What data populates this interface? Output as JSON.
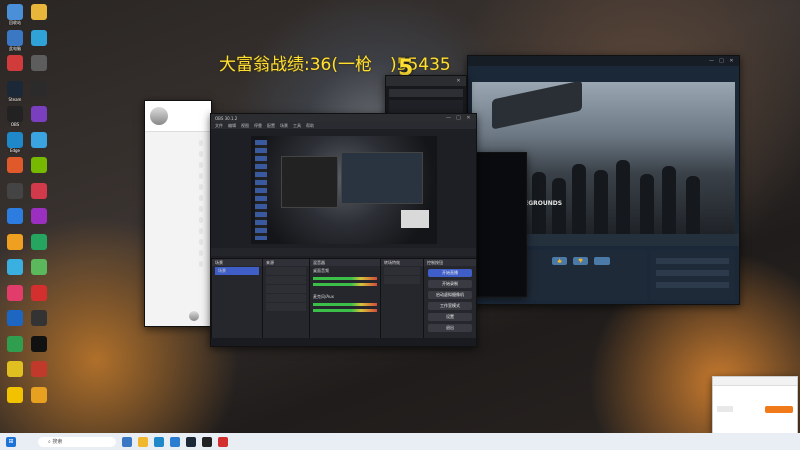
{
  "overlay": {
    "stats_text": "大富翁战绩:36(一枪",
    "stats_suffix": ")55435",
    "big_digit": "5"
  },
  "desktop_icons": [
    {
      "name": "recycle-bin-icon",
      "label": "回收站",
      "color": "#4a90d9"
    },
    {
      "name": "app-icon-2",
      "label": "",
      "color": "#e8b63a"
    },
    {
      "name": "computer-icon",
      "label": "此电脑",
      "color": "#3a78c4"
    },
    {
      "name": "app-icon-4",
      "label": "",
      "color": "#2fa3d8"
    },
    {
      "name": "app-icon-5",
      "label": "",
      "color": "#d23b3b"
    },
    {
      "name": "app-icon-6",
      "label": "",
      "color": "#5d5d5d"
    },
    {
      "name": "steam-icon",
      "label": "Steam",
      "color": "#1b2838"
    },
    {
      "name": "app-icon-8",
      "label": "",
      "color": "#2b2b2b"
    },
    {
      "name": "obs-icon",
      "label": "OBS",
      "color": "#222"
    },
    {
      "name": "app-icon-10",
      "label": "",
      "color": "#7a3fbf"
    },
    {
      "name": "edge-icon",
      "label": "Edge",
      "color": "#1e88c8"
    },
    {
      "name": "app-icon-12",
      "label": "",
      "color": "#3aa3e0"
    },
    {
      "name": "app-icon-13",
      "label": "",
      "color": "#e0592b"
    },
    {
      "name": "nvidia-icon",
      "label": "",
      "color": "#76b900"
    },
    {
      "name": "app-icon-15",
      "label": "",
      "color": "#444"
    },
    {
      "name": "app-icon-16",
      "label": "",
      "color": "#d13a4a"
    },
    {
      "name": "app-icon-17",
      "label": "",
      "color": "#2d7de0"
    },
    {
      "name": "app-icon-18",
      "label": "",
      "color": "#9b2fbf"
    },
    {
      "name": "app-icon-19",
      "label": "",
      "color": "#f0a020"
    },
    {
      "name": "app-icon-20",
      "label": "",
      "color": "#25a55f"
    },
    {
      "name": "app-icon-21",
      "label": "",
      "color": "#3ab0e0"
    },
    {
      "name": "app-icon-22",
      "label": "",
      "color": "#5cb85c"
    },
    {
      "name": "app-icon-23",
      "label": "",
      "color": "#e23c6a"
    },
    {
      "name": "app-icon-24",
      "label": "",
      "color": "#d32f2f"
    },
    {
      "name": "app-icon-25",
      "label": "",
      "color": "#1d66c2"
    },
    {
      "name": "app-icon-26",
      "label": "",
      "color": "#333"
    },
    {
      "name": "app-icon-27",
      "label": "",
      "color": "#2f9e4f"
    },
    {
      "name": "app-icon-28",
      "label": "",
      "color": "#111"
    },
    {
      "name": "app-icon-29",
      "label": "",
      "color": "#e0c020"
    },
    {
      "name": "app-icon-30",
      "label": "",
      "color": "#c0392b"
    },
    {
      "name": "app-icon-31",
      "label": "",
      "color": "#f2c200"
    },
    {
      "name": "app-icon-32",
      "label": "",
      "color": "#e8a020"
    }
  ],
  "obs": {
    "title": "OBS 30.1.2",
    "menu": [
      "文件",
      "编辑",
      "视图",
      "停靠",
      "配置",
      "场景",
      "工具",
      "帮助"
    ],
    "docks": {
      "scenes": "场景",
      "sources": "来源",
      "mixer": "混音器",
      "transitions": "转场特效",
      "controls": "控制按钮"
    },
    "scene_item": "场景",
    "source_items": [
      "",
      "",
      "",
      "",
      ""
    ],
    "mixer_tracks": [
      "桌面音频",
      "麦克风/Aux"
    ],
    "controls": [
      "开始直播",
      "开始录制",
      "启动虚拟摄像机",
      "工作室模式",
      "设置",
      "退出"
    ],
    "status": ""
  },
  "steam": {
    "tabs": [
      "",
      "",
      "",
      ""
    ],
    "game_title": "PUBG: BATTLEGROUNDS",
    "review_buttons": [
      "",
      "",
      ""
    ]
  },
  "popup": {
    "title": "",
    "message": "",
    "confirm": "",
    "cancel": ""
  },
  "taskbar": {
    "search_placeholder": "搜索",
    "time": "",
    "date": ""
  }
}
